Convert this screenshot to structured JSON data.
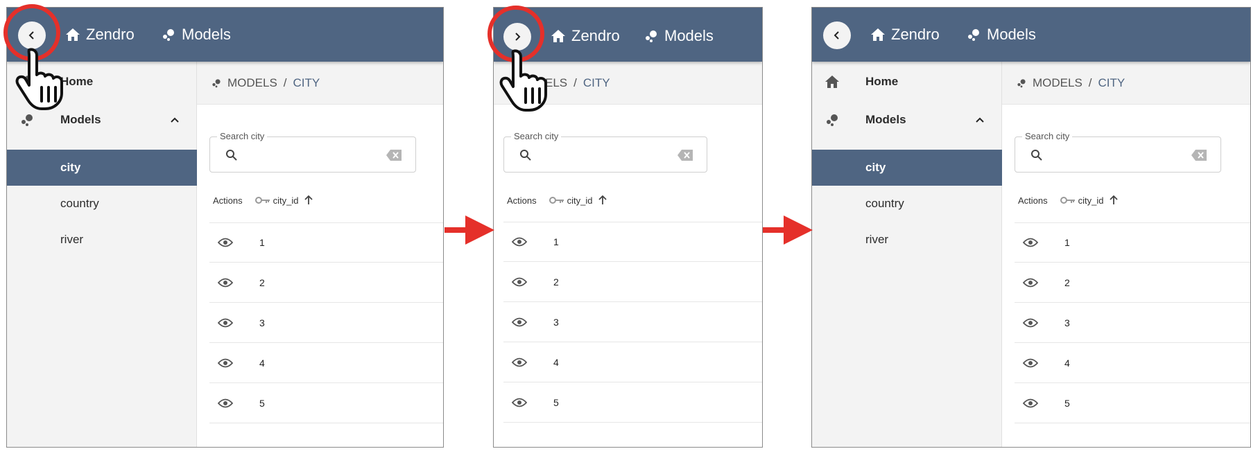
{
  "app": {
    "home_link": "Zendro",
    "models_link": "Models"
  },
  "sidebar": {
    "home": "Home",
    "models": "Models",
    "items": [
      "city",
      "country",
      "river"
    ]
  },
  "breadcrumb": {
    "models": "MODELS",
    "separator": "/",
    "current": "CITY",
    "models_partial": "ELS"
  },
  "search": {
    "label": "Search city"
  },
  "table": {
    "actions_header": "Actions",
    "id_header": "city_id",
    "rows": [
      "1",
      "2",
      "3",
      "4",
      "5"
    ]
  },
  "colors": {
    "appbar": "#4f6582",
    "highlight_circle": "#e5302a",
    "flow_arrow": "#e5302a"
  },
  "icons": {
    "toggle_collapse": "chevron-left-icon",
    "toggle_expand": "chevron-right-icon",
    "home": "home-icon",
    "models": "models-icon",
    "search": "search-icon",
    "clear": "backspace-icon",
    "key": "key-icon",
    "sort": "arrow-up-icon",
    "view": "eye-icon",
    "pointer": "hand-pointer-icon"
  }
}
